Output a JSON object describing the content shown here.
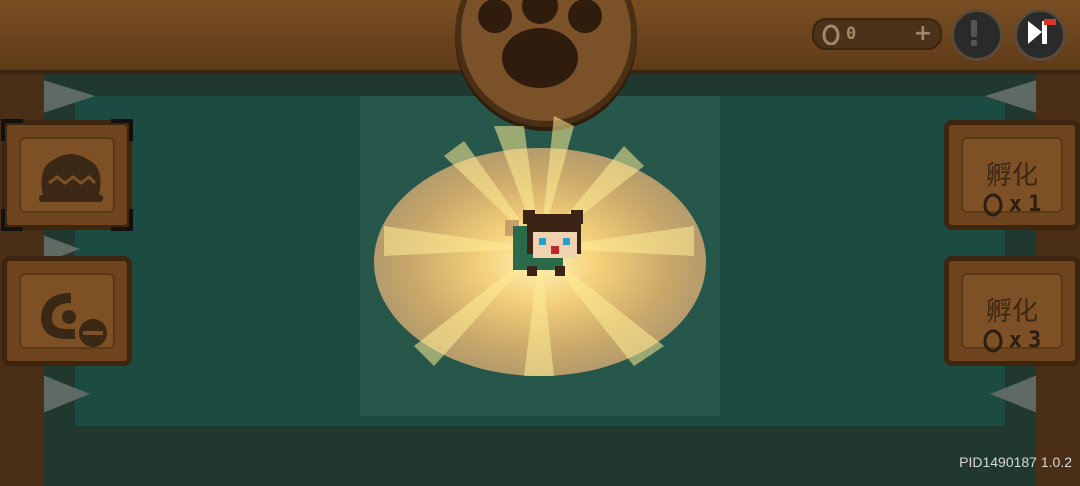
{
  "hud": {
    "currency_amount": "0",
    "currency_add_symbol": "+",
    "alert_icon": "exclamation-icon",
    "skip_icon": "fast-forward-icon"
  },
  "left_panel": {
    "items": [
      {
        "name": "egg-basket",
        "icon": "egg-nest-icon",
        "selected": true
      },
      {
        "name": "incubator",
        "icon": "swirl-lock-icon",
        "selected": false
      }
    ]
  },
  "right_panel": {
    "hatch_buttons": [
      {
        "label": "孵化",
        "multiplier": "x",
        "count": "1",
        "icon": "egg-icon"
      },
      {
        "label": "孵化",
        "multiplier": "x",
        "count": "3",
        "icon": "egg-icon"
      }
    ]
  },
  "center": {
    "pet": "pixel-dog-pet",
    "effect": "golden-spotlight"
  },
  "footer": {
    "build_info": "PID1490187 1.0.2"
  },
  "colors": {
    "wood": "#6e451f",
    "felt": "#1d5247",
    "glow": "#f4d17a"
  }
}
